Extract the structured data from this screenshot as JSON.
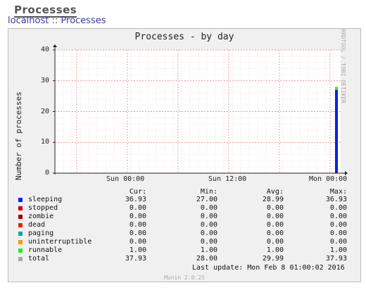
{
  "page": {
    "title": "Processes",
    "breadcrumb": {
      "host": "localhost",
      "separator": "::",
      "current": "Processes"
    }
  },
  "chart_data": {
    "type": "area",
    "title": "Processes - by day",
    "ylabel": "Number of processes",
    "ylim": [
      0,
      40
    ],
    "yticks": [
      "0",
      "10",
      "20",
      "30",
      "40"
    ],
    "xticks": [
      "Sun 00:00",
      "Sun 12:00",
      "Mon 00:00"
    ],
    "side_credit": "RRDTOOL / TOBI OETIKER",
    "stacked_at_end": [
      {
        "name": "sleeping",
        "value": 27.0,
        "color": "#0022ee"
      },
      {
        "name": "runnable",
        "value": 1.0,
        "color": "#22ee22"
      }
    ],
    "columns": [
      "Cur:",
      "Min:",
      "Avg:",
      "Max:"
    ],
    "series": [
      {
        "name": "sleeping",
        "color": "#0022ee",
        "values": [
          "36.93",
          "27.00",
          "28.99",
          "36.93"
        ]
      },
      {
        "name": "stopped",
        "color": "#cc0000",
        "values": [
          "0.00",
          "0.00",
          "0.00",
          "0.00"
        ]
      },
      {
        "name": "zombie",
        "color": "#990000",
        "values": [
          "0.00",
          "0.00",
          "0.00",
          "0.00"
        ]
      },
      {
        "name": "dead",
        "color": "#ee2200",
        "values": [
          "0.00",
          "0.00",
          "0.00",
          "0.00"
        ]
      },
      {
        "name": "paging",
        "color": "#00aaaa",
        "values": [
          "0.00",
          "0.00",
          "0.00",
          "0.00"
        ]
      },
      {
        "name": "uninterruptible",
        "color": "#ff9900",
        "values": [
          "0.00",
          "0.00",
          "0.00",
          "0.00"
        ]
      },
      {
        "name": "runnable",
        "color": "#22ee22",
        "values": [
          "1.00",
          "1.00",
          "1.00",
          "1.00"
        ]
      },
      {
        "name": "total",
        "color": "#aaaaaa",
        "values": [
          "37.93",
          "28.00",
          "29.99",
          "37.93"
        ]
      }
    ],
    "last_update": "Last update:  Mon Feb  8 01:00:02 2016",
    "version": "Munin 2.0.25"
  }
}
